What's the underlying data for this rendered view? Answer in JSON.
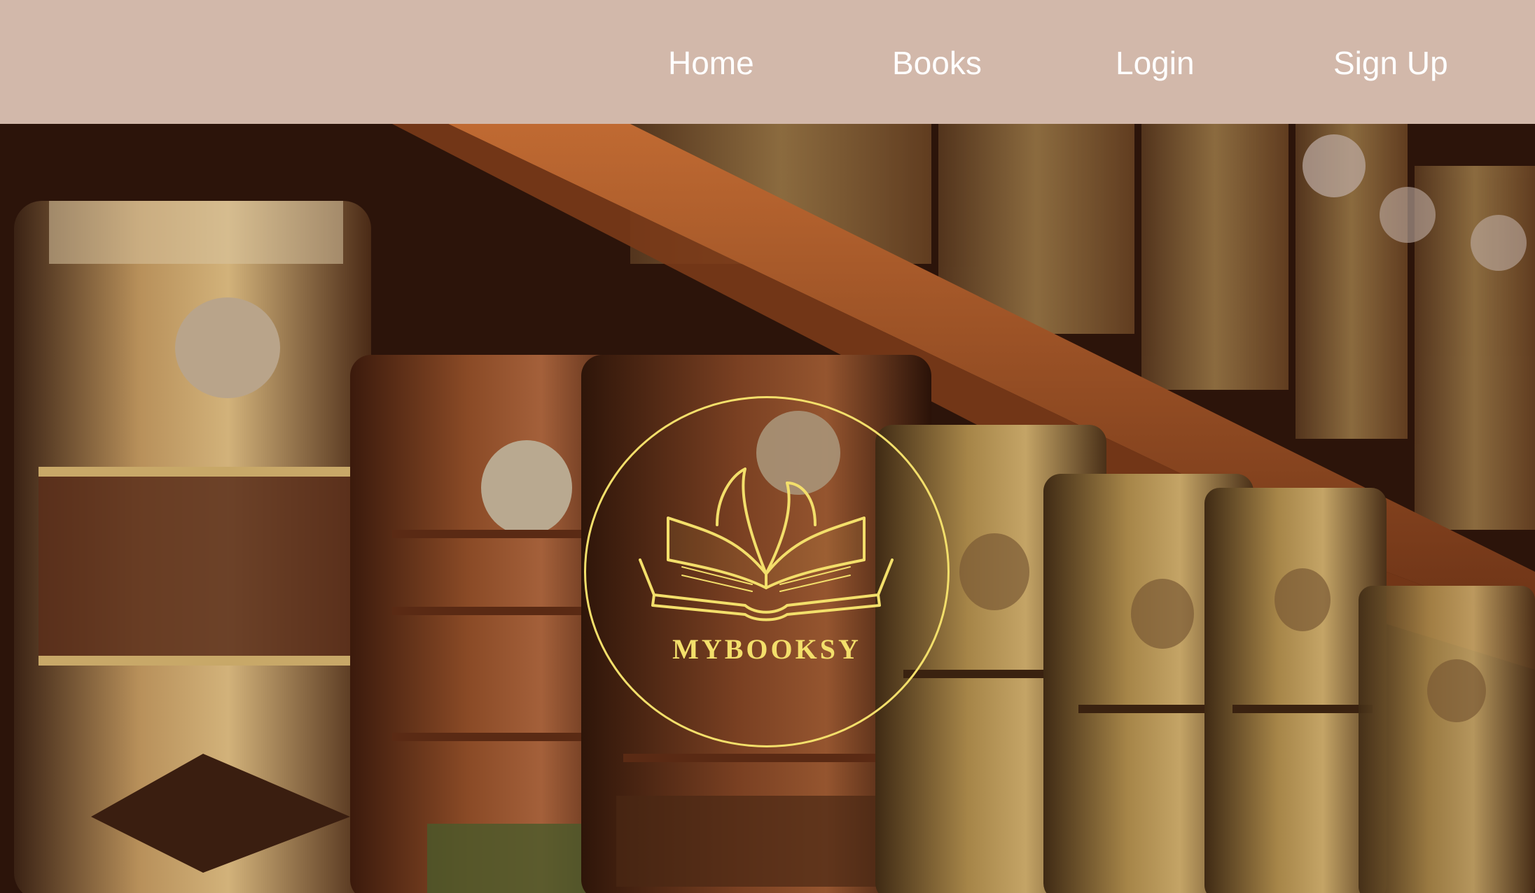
{
  "nav": {
    "home": "Home",
    "books": "Books",
    "login": "Login",
    "signup": "Sign Up"
  },
  "logo": {
    "text": "MYBOOKSY",
    "icon": "open-book-icon",
    "color": "#f3df6b"
  },
  "hero": {
    "image": "antique-books-on-shelf"
  },
  "colors": {
    "navbar_bg": "#d2b8aa",
    "nav_text": "#ffffff",
    "logo_accent": "#f3df6b"
  }
}
